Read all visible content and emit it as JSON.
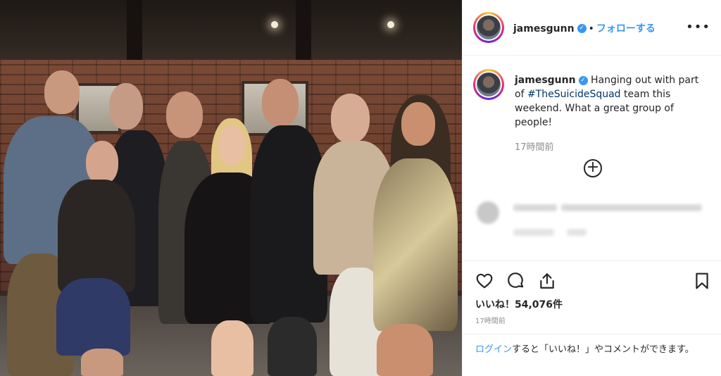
{
  "post": {
    "username": "jamesgunn",
    "verified_badge": "✓",
    "separator": "•",
    "follow_label": "フォローする",
    "more_label": "•••",
    "caption": {
      "prefix": "Hanging out with part of ",
      "hashtag": "#TheSuicideSquad",
      "suffix": " team this weekend. What a great group of people!"
    },
    "caption_time": "17時間前",
    "load_more_icon": "plus-circle-icon",
    "likes_label": "いいね！54,076件",
    "post_time": "17時間前",
    "login_prompt": {
      "link": "ログイン",
      "text": "すると「いいね！」やコメントができます。"
    }
  },
  "icons": {
    "like": "heart-icon",
    "comment": "comment-icon",
    "share": "share-icon",
    "save": "bookmark-icon"
  },
  "colors": {
    "link_blue": "#3897f0",
    "hashtag": "#003569",
    "muted": "#8e8e8e",
    "text": "#262626",
    "border": "#efefef"
  }
}
